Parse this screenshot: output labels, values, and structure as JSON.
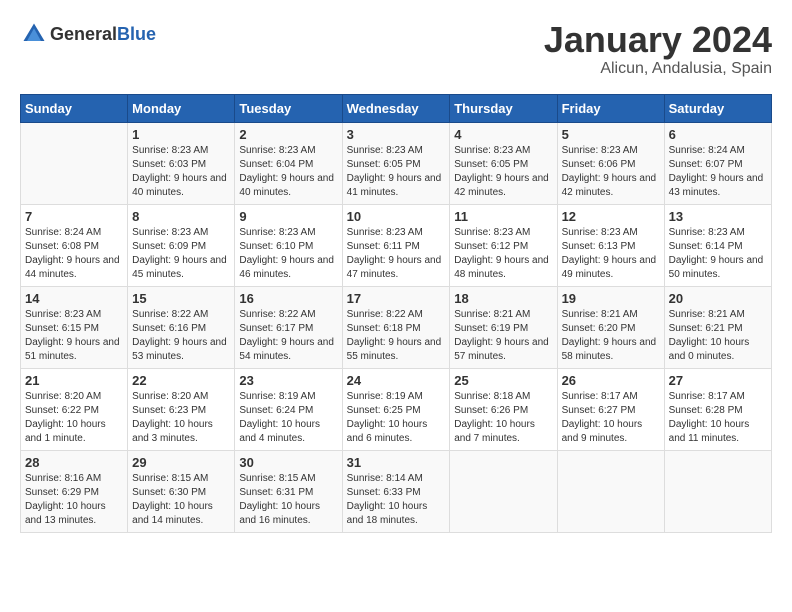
{
  "header": {
    "logo_general": "General",
    "logo_blue": "Blue",
    "month": "January 2024",
    "location": "Alicun, Andalusia, Spain"
  },
  "weekdays": [
    "Sunday",
    "Monday",
    "Tuesday",
    "Wednesday",
    "Thursday",
    "Friday",
    "Saturday"
  ],
  "weeks": [
    [
      {
        "day": "",
        "sunrise": "",
        "sunset": "",
        "daylight": ""
      },
      {
        "day": "1",
        "sunrise": "Sunrise: 8:23 AM",
        "sunset": "Sunset: 6:03 PM",
        "daylight": "Daylight: 9 hours and 40 minutes."
      },
      {
        "day": "2",
        "sunrise": "Sunrise: 8:23 AM",
        "sunset": "Sunset: 6:04 PM",
        "daylight": "Daylight: 9 hours and 40 minutes."
      },
      {
        "day": "3",
        "sunrise": "Sunrise: 8:23 AM",
        "sunset": "Sunset: 6:05 PM",
        "daylight": "Daylight: 9 hours and 41 minutes."
      },
      {
        "day": "4",
        "sunrise": "Sunrise: 8:23 AM",
        "sunset": "Sunset: 6:05 PM",
        "daylight": "Daylight: 9 hours and 42 minutes."
      },
      {
        "day": "5",
        "sunrise": "Sunrise: 8:23 AM",
        "sunset": "Sunset: 6:06 PM",
        "daylight": "Daylight: 9 hours and 42 minutes."
      },
      {
        "day": "6",
        "sunrise": "Sunrise: 8:24 AM",
        "sunset": "Sunset: 6:07 PM",
        "daylight": "Daylight: 9 hours and 43 minutes."
      }
    ],
    [
      {
        "day": "7",
        "sunrise": "Sunrise: 8:24 AM",
        "sunset": "Sunset: 6:08 PM",
        "daylight": "Daylight: 9 hours and 44 minutes."
      },
      {
        "day": "8",
        "sunrise": "Sunrise: 8:23 AM",
        "sunset": "Sunset: 6:09 PM",
        "daylight": "Daylight: 9 hours and 45 minutes."
      },
      {
        "day": "9",
        "sunrise": "Sunrise: 8:23 AM",
        "sunset": "Sunset: 6:10 PM",
        "daylight": "Daylight: 9 hours and 46 minutes."
      },
      {
        "day": "10",
        "sunrise": "Sunrise: 8:23 AM",
        "sunset": "Sunset: 6:11 PM",
        "daylight": "Daylight: 9 hours and 47 minutes."
      },
      {
        "day": "11",
        "sunrise": "Sunrise: 8:23 AM",
        "sunset": "Sunset: 6:12 PM",
        "daylight": "Daylight: 9 hours and 48 minutes."
      },
      {
        "day": "12",
        "sunrise": "Sunrise: 8:23 AM",
        "sunset": "Sunset: 6:13 PM",
        "daylight": "Daylight: 9 hours and 49 minutes."
      },
      {
        "day": "13",
        "sunrise": "Sunrise: 8:23 AM",
        "sunset": "Sunset: 6:14 PM",
        "daylight": "Daylight: 9 hours and 50 minutes."
      }
    ],
    [
      {
        "day": "14",
        "sunrise": "Sunrise: 8:23 AM",
        "sunset": "Sunset: 6:15 PM",
        "daylight": "Daylight: 9 hours and 51 minutes."
      },
      {
        "day": "15",
        "sunrise": "Sunrise: 8:22 AM",
        "sunset": "Sunset: 6:16 PM",
        "daylight": "Daylight: 9 hours and 53 minutes."
      },
      {
        "day": "16",
        "sunrise": "Sunrise: 8:22 AM",
        "sunset": "Sunset: 6:17 PM",
        "daylight": "Daylight: 9 hours and 54 minutes."
      },
      {
        "day": "17",
        "sunrise": "Sunrise: 8:22 AM",
        "sunset": "Sunset: 6:18 PM",
        "daylight": "Daylight: 9 hours and 55 minutes."
      },
      {
        "day": "18",
        "sunrise": "Sunrise: 8:21 AM",
        "sunset": "Sunset: 6:19 PM",
        "daylight": "Daylight: 9 hours and 57 minutes."
      },
      {
        "day": "19",
        "sunrise": "Sunrise: 8:21 AM",
        "sunset": "Sunset: 6:20 PM",
        "daylight": "Daylight: 9 hours and 58 minutes."
      },
      {
        "day": "20",
        "sunrise": "Sunrise: 8:21 AM",
        "sunset": "Sunset: 6:21 PM",
        "daylight": "Daylight: 10 hours and 0 minutes."
      }
    ],
    [
      {
        "day": "21",
        "sunrise": "Sunrise: 8:20 AM",
        "sunset": "Sunset: 6:22 PM",
        "daylight": "Daylight: 10 hours and 1 minute."
      },
      {
        "day": "22",
        "sunrise": "Sunrise: 8:20 AM",
        "sunset": "Sunset: 6:23 PM",
        "daylight": "Daylight: 10 hours and 3 minutes."
      },
      {
        "day": "23",
        "sunrise": "Sunrise: 8:19 AM",
        "sunset": "Sunset: 6:24 PM",
        "daylight": "Daylight: 10 hours and 4 minutes."
      },
      {
        "day": "24",
        "sunrise": "Sunrise: 8:19 AM",
        "sunset": "Sunset: 6:25 PM",
        "daylight": "Daylight: 10 hours and 6 minutes."
      },
      {
        "day": "25",
        "sunrise": "Sunrise: 8:18 AM",
        "sunset": "Sunset: 6:26 PM",
        "daylight": "Daylight: 10 hours and 7 minutes."
      },
      {
        "day": "26",
        "sunrise": "Sunrise: 8:17 AM",
        "sunset": "Sunset: 6:27 PM",
        "daylight": "Daylight: 10 hours and 9 minutes."
      },
      {
        "day": "27",
        "sunrise": "Sunrise: 8:17 AM",
        "sunset": "Sunset: 6:28 PM",
        "daylight": "Daylight: 10 hours and 11 minutes."
      }
    ],
    [
      {
        "day": "28",
        "sunrise": "Sunrise: 8:16 AM",
        "sunset": "Sunset: 6:29 PM",
        "daylight": "Daylight: 10 hours and 13 minutes."
      },
      {
        "day": "29",
        "sunrise": "Sunrise: 8:15 AM",
        "sunset": "Sunset: 6:30 PM",
        "daylight": "Daylight: 10 hours and 14 minutes."
      },
      {
        "day": "30",
        "sunrise": "Sunrise: 8:15 AM",
        "sunset": "Sunset: 6:31 PM",
        "daylight": "Daylight: 10 hours and 16 minutes."
      },
      {
        "day": "31",
        "sunrise": "Sunrise: 8:14 AM",
        "sunset": "Sunset: 6:33 PM",
        "daylight": "Daylight: 10 hours and 18 minutes."
      },
      {
        "day": "",
        "sunrise": "",
        "sunset": "",
        "daylight": ""
      },
      {
        "day": "",
        "sunrise": "",
        "sunset": "",
        "daylight": ""
      },
      {
        "day": "",
        "sunrise": "",
        "sunset": "",
        "daylight": ""
      }
    ]
  ]
}
